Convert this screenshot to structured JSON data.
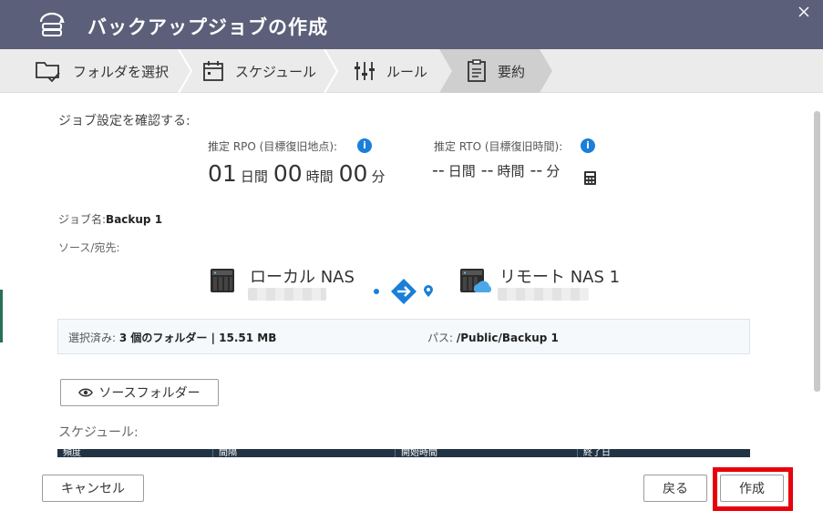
{
  "window": {
    "title": "バックアップジョブの作成",
    "close_icon": "close-icon"
  },
  "steps": [
    {
      "label": "フォルダを選択",
      "icon": "folder-check-icon"
    },
    {
      "label": "スケジュール",
      "icon": "calendar-icon"
    },
    {
      "label": "ルール",
      "icon": "sliders-icon"
    },
    {
      "label": "要約",
      "icon": "clipboard-icon",
      "active": true
    }
  ],
  "summary": {
    "heading": "ジョブ設定を確認する:",
    "rpo": {
      "label": "推定 RPO (目標復旧地点):",
      "days": "01",
      "days_unit": "日間",
      "hours": "00",
      "hours_unit": "時間",
      "minutes": "00",
      "minutes_unit": "分"
    },
    "rto": {
      "label": "推定 RTO (目標復旧時間):",
      "days": "--",
      "days_unit": "日間",
      "hours": "--",
      "hours_unit": "時間",
      "minutes": "--",
      "minutes_unit": "分"
    },
    "info_glyph": "i",
    "job_name_label": "ジョブ名:",
    "job_name": "Backup 1",
    "source_dest_label": "ソース/宛先:",
    "local_nas": "ローカル NAS",
    "remote_nas": "リモート NAS 1",
    "selected_label": "選択済み:",
    "selected_value": "3 個のフォルダー | 15.51 MB",
    "path_label": "パス:",
    "path_value": "/Public/Backup 1",
    "source_folder_button": "ソースフォルダー",
    "schedule_label": "スケジュール:",
    "schedule_columns": [
      "頻度",
      "間隔",
      "開始時間",
      "終了日"
    ]
  },
  "footer": {
    "cancel": "キャンセル",
    "back": "戻る",
    "create": "作成"
  },
  "colors": {
    "titlebar": "#5c5f7a",
    "accent": "#1a7fd8",
    "highlight": "#e8000b"
  }
}
